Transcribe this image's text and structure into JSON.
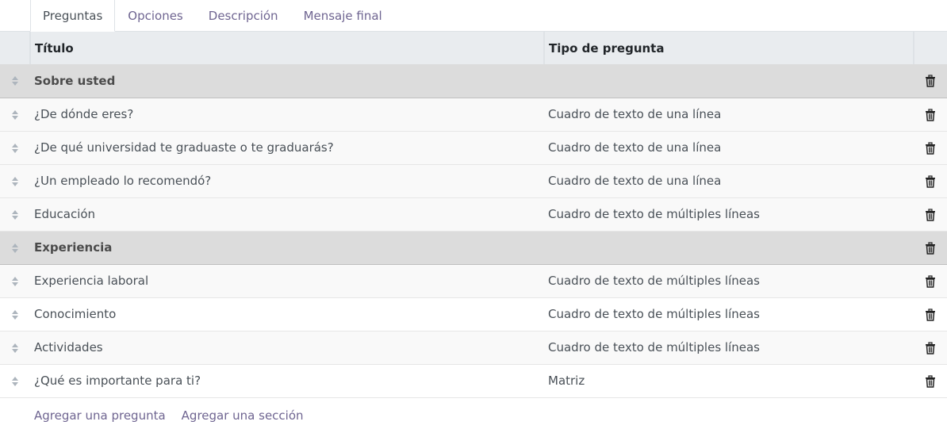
{
  "tabs": [
    {
      "label": "Preguntas",
      "active": true
    },
    {
      "label": "Opciones",
      "active": false
    },
    {
      "label": "Descripción",
      "active": false
    },
    {
      "label": "Mensaje final",
      "active": false
    }
  ],
  "table": {
    "headers": {
      "title": "Título",
      "type": "Tipo de pregunta"
    },
    "rows": [
      {
        "kind": "section",
        "title": "Sobre usted",
        "type": ""
      },
      {
        "kind": "question",
        "title": "¿De dónde eres?",
        "type": "Cuadro de texto de una línea"
      },
      {
        "kind": "question",
        "title": "¿De qué universidad te graduaste o te graduarás?",
        "type": "Cuadro de texto de una línea"
      },
      {
        "kind": "question",
        "title": "¿Un empleado lo recomendó?",
        "type": "Cuadro de texto de una línea"
      },
      {
        "kind": "question",
        "title": "Educación",
        "type": "Cuadro de texto de múltiples líneas"
      },
      {
        "kind": "section",
        "title": "Experiencia",
        "type": ""
      },
      {
        "kind": "question",
        "title": "Experiencia laboral",
        "type": "Cuadro de texto de múltiples líneas"
      },
      {
        "kind": "question",
        "title": "Conocimiento",
        "type": "Cuadro de texto de múltiples líneas"
      },
      {
        "kind": "question",
        "title": "Actividades",
        "type": "Cuadro de texto de múltiples líneas"
      },
      {
        "kind": "question",
        "title": "¿Qué es importante para ti?",
        "type": "Matriz"
      }
    ]
  },
  "footer": {
    "add_question": "Agregar una pregunta",
    "add_section": "Agregar una sección"
  },
  "icons": {
    "handle": "sort-handle-icon",
    "delete": "trash-icon"
  },
  "colors": {
    "link": "#6f6591",
    "header_bg": "#e9ecef",
    "section_bg": "#dcdcdc",
    "stripe_bg": "#f9f9f9"
  }
}
